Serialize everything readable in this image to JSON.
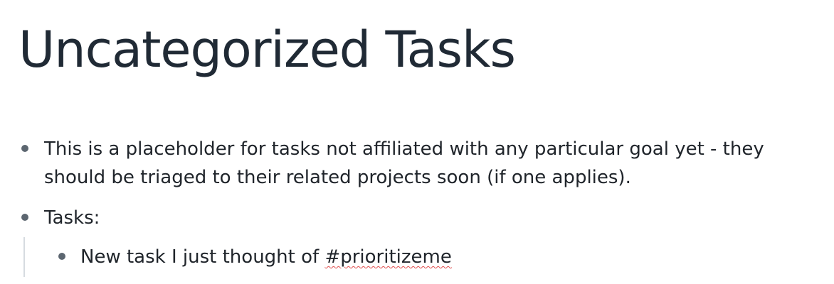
{
  "page": {
    "title": "Uncategorized Tasks"
  },
  "blocks": [
    {
      "text": "This is a placeholder for tasks not affiliated with any particular goal yet - they should be triaged to their related projects soon (if one applies)."
    },
    {
      "text": "Tasks:",
      "children": [
        {
          "text_prefix": "New task I just thought of ",
          "tag": "#prioritizeme"
        }
      ]
    }
  ],
  "colors": {
    "title": "#202a35",
    "text": "#20252b",
    "bullet": "#5c6670",
    "spellcheck_underline": "#e05252",
    "child_indent_line": "#d6dbe0"
  }
}
